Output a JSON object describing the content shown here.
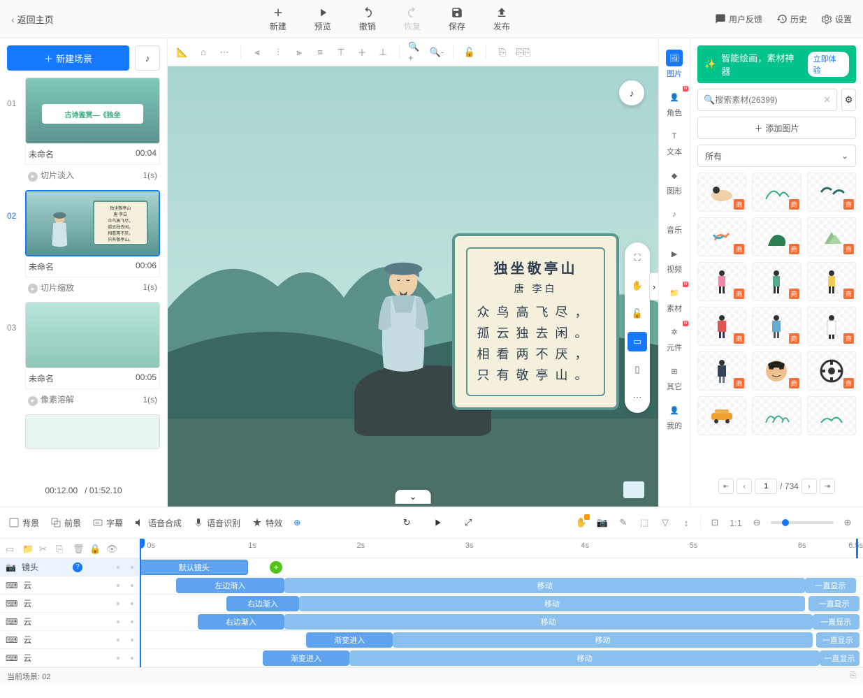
{
  "topbar": {
    "back": "返回主页",
    "new": "新建",
    "preview": "预览",
    "undo": "撤销",
    "redo": "恢复",
    "save": "保存",
    "publish": "发布",
    "feedback": "用户反馈",
    "history": "历史",
    "settings": "设置"
  },
  "sidebar": {
    "new_scene": "新建场景",
    "scenes": [
      {
        "num": "01",
        "name": "未命名",
        "dur": "00:04",
        "trans": "切片淡入",
        "trans_dur": "1(s)",
        "thumb_title": "古诗鉴赏—《独坐"
      },
      {
        "num": "02",
        "name": "未命名",
        "dur": "00:06",
        "trans": "切片缩放",
        "trans_dur": "1(s)"
      },
      {
        "num": "03",
        "name": "未命名",
        "dur": "00:05",
        "trans": "像素溶解",
        "trans_dur": "1(s)"
      }
    ],
    "time_pos": "00:12.00",
    "time_total": "/ 01:52.10"
  },
  "poem": {
    "title": "独坐敬亭山",
    "author": "唐 李白",
    "lines": [
      "众鸟高飞尽，",
      "孤云独去闲。",
      "相看两不厌，",
      "只有敬亭山。"
    ],
    "thumb_lines": "独坐敬亭山\n唐 李白\n众鸟高飞尽，\n孤云独去闲。\n相看两不厌，\n只有敬亭山。"
  },
  "resource_tabs": {
    "image": "图片",
    "character": "角色",
    "text": "文本",
    "shape": "图形",
    "music": "音乐",
    "video": "视频",
    "material": "素材",
    "component": "元件",
    "other": "其它",
    "mine": "我的"
  },
  "right_panel": {
    "ai_text": "智能绘画，素材神器",
    "ai_btn": "立即体验",
    "search_placeholder": "搜索素材(26399)",
    "add_image": "添加图片",
    "category": "所有",
    "asset_badge": "商",
    "page_current": "1",
    "page_total": "/ 734"
  },
  "timeline_tabs": {
    "background": "背景",
    "foreground": "前景",
    "subtitle": "字幕",
    "tts": "语音合成",
    "asr": "语音识别",
    "fx": "特效"
  },
  "ruler": [
    "0s",
    "1s",
    "2s",
    "3s",
    "4s",
    "5s",
    "6s",
    "6.5s"
  ],
  "tracks": {
    "camera": "镜头",
    "cloud": "云",
    "default_camera": "默认镜头",
    "left_in": "左边渐入",
    "right_in": "右边渐入",
    "fade_in": "渐变进入",
    "move": "移动",
    "always_show": "一直显示"
  },
  "statusbar": {
    "current": "当前场景: 02"
  }
}
